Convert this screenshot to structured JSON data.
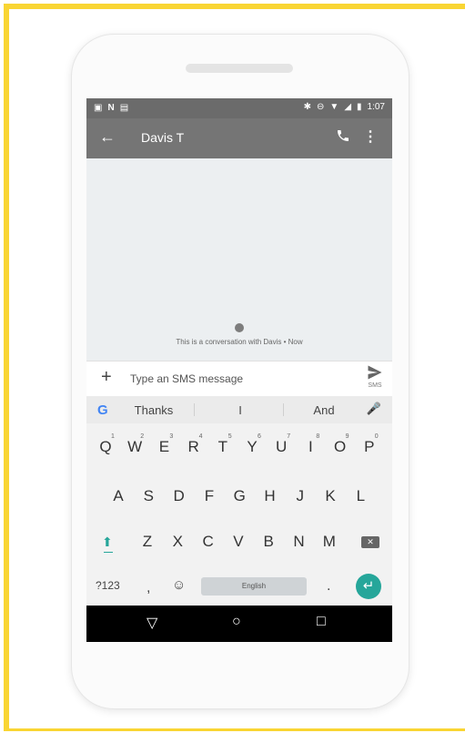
{
  "status_bar": {
    "time": "1:07",
    "left_icons": [
      "image-icon",
      "n-icon",
      "card-icon"
    ],
    "right_icons": [
      "bluetooth-icon",
      "do-not-disturb-icon",
      "wifi-icon",
      "signal-icon",
      "battery-icon"
    ]
  },
  "app_bar": {
    "title": "Davis T",
    "back_icon": "arrow-left-icon",
    "call_icon": "phone-icon",
    "more_icon": "more-vert-icon"
  },
  "conversation": {
    "info_text": "This is a conversation with Davis • Now"
  },
  "composer": {
    "placeholder": "Type an SMS message",
    "send_label": "SMS"
  },
  "keyboard": {
    "suggestions": [
      "Thanks",
      "I",
      "And"
    ],
    "row1": [
      {
        "k": "Q",
        "h": "1"
      },
      {
        "k": "W",
        "h": "2"
      },
      {
        "k": "E",
        "h": "3"
      },
      {
        "k": "R",
        "h": "4"
      },
      {
        "k": "T",
        "h": "5"
      },
      {
        "k": "Y",
        "h": "6"
      },
      {
        "k": "U",
        "h": "7"
      },
      {
        "k": "I",
        "h": "8"
      },
      {
        "k": "O",
        "h": "9"
      },
      {
        "k": "P",
        "h": "0"
      }
    ],
    "row2": [
      "A",
      "S",
      "D",
      "F",
      "G",
      "H",
      "J",
      "K",
      "L"
    ],
    "row3": [
      "Z",
      "X",
      "C",
      "V",
      "B",
      "N",
      "M"
    ],
    "symbols_label": "?123",
    "comma": ",",
    "period": ".",
    "space_label": "English",
    "accent_color": "#26a69a"
  },
  "nav": {
    "back": "▽",
    "home": "○",
    "recents": "□"
  }
}
